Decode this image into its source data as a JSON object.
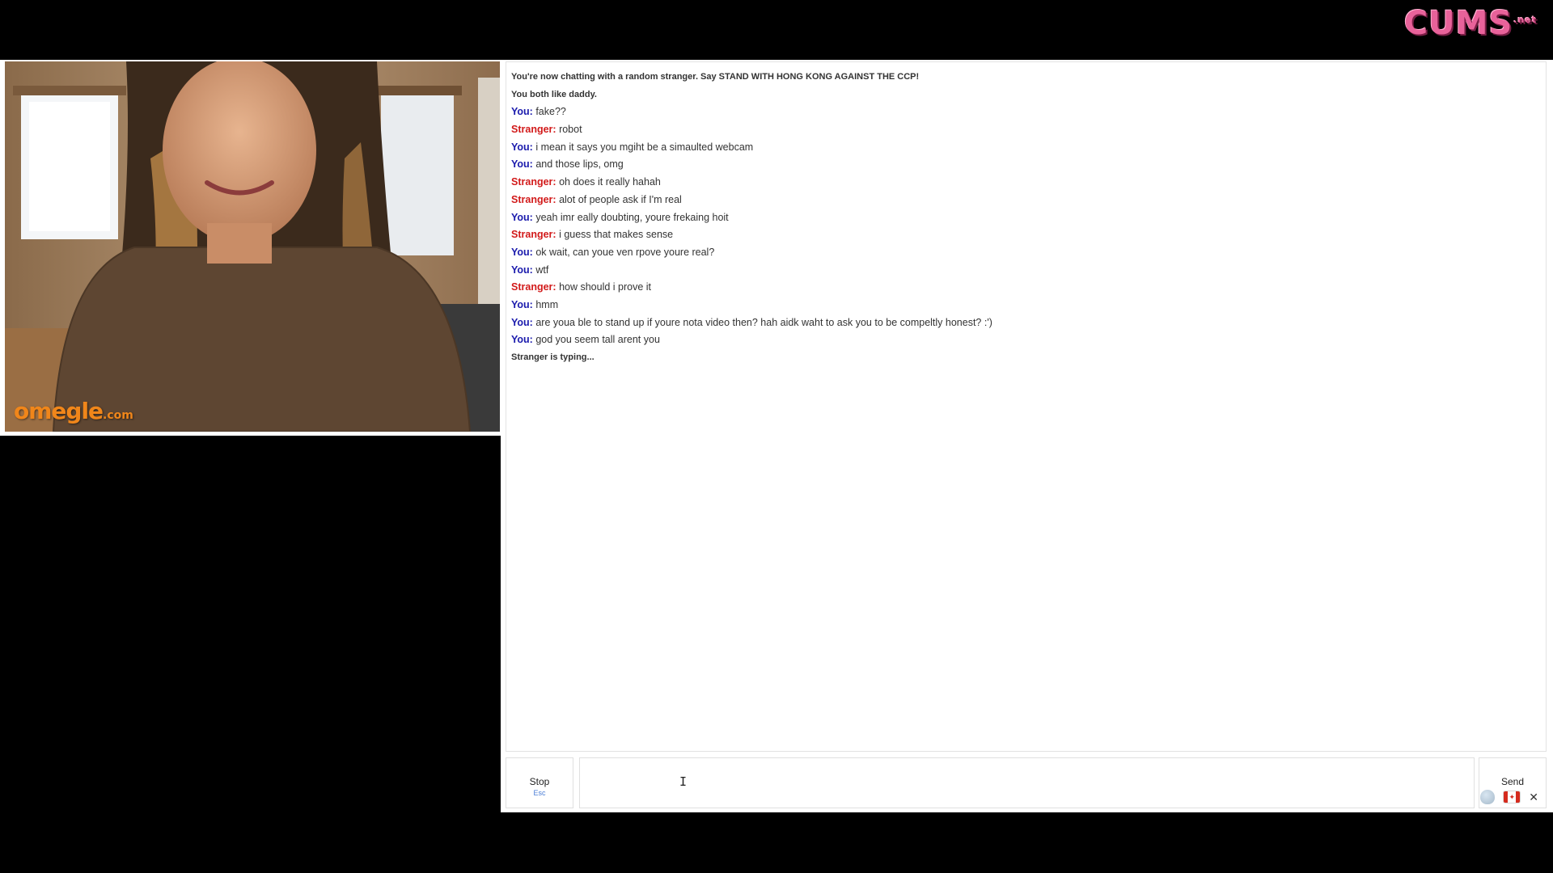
{
  "watermark": {
    "text": "CUMS",
    "suffix": ".net"
  },
  "video": {
    "logo_main": "omegle",
    "logo_suffix": ".com"
  },
  "chat": {
    "lines": [
      {
        "kind": "status",
        "text": "You're now chatting with a random stranger. Say STAND WITH HONG KONG AGAINST THE CCP!"
      },
      {
        "kind": "status",
        "text": "You both like daddy."
      },
      {
        "kind": "you",
        "who": "You:",
        "text": "fake??"
      },
      {
        "kind": "stranger",
        "who": "Stranger:",
        "text": "robot"
      },
      {
        "kind": "you",
        "who": "You:",
        "text": "i mean it says you mgiht be a simaulted webcam"
      },
      {
        "kind": "you",
        "who": "You:",
        "text": "and those lips, omg"
      },
      {
        "kind": "stranger",
        "who": "Stranger:",
        "text": "oh does it really hahah"
      },
      {
        "kind": "stranger",
        "who": "Stranger:",
        "text": "alot of people ask if I'm real"
      },
      {
        "kind": "you",
        "who": "You:",
        "text": "yeah imr eally doubting, youre frekaing hoit"
      },
      {
        "kind": "stranger",
        "who": "Stranger:",
        "text": "i guess that makes sense"
      },
      {
        "kind": "you",
        "who": "You:",
        "text": "ok wait, can youe ven rpove youre real?"
      },
      {
        "kind": "you",
        "who": "You:",
        "text": "wtf"
      },
      {
        "kind": "stranger",
        "who": "Stranger:",
        "text": "how should i prove it"
      },
      {
        "kind": "you",
        "who": "You:",
        "text": "hmm"
      },
      {
        "kind": "you",
        "who": "You:",
        "text": "are youa ble to stand up if youre nota video then? hah aidk waht to ask you to be compeltly honest? :')"
      },
      {
        "kind": "you",
        "who": "You:",
        "text": "god you seem tall arent you"
      },
      {
        "kind": "status",
        "text": "Stranger is typing..."
      }
    ]
  },
  "controls": {
    "stop_label": "Stop",
    "stop_hint": "Esc",
    "input_value": "",
    "send_label": "Send"
  },
  "icons": {
    "blob": "ghost-blob-icon",
    "flag": "canada-flag-icon",
    "close": "close-icon"
  },
  "colors": {
    "you": "#1b1bad",
    "stranger": "#d21a1a",
    "logo": "#f0861a",
    "watermark": "#e8629a"
  }
}
